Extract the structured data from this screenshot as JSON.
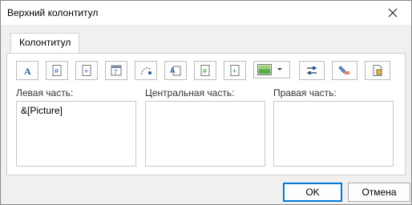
{
  "window": {
    "title": "Верхний колонтитул"
  },
  "tabs": [
    {
      "label": "Колонтитул"
    }
  ],
  "toolbar": {
    "buttons": [
      {
        "icon": "font-icon"
      },
      {
        "icon": "page-number-icon"
      },
      {
        "icon": "total-pages-icon"
      },
      {
        "icon": "date-icon"
      },
      {
        "icon": "time-icon"
      },
      {
        "icon": "file-path-icon"
      },
      {
        "icon": "file-name-icon"
      },
      {
        "icon": "sheet-name-icon"
      },
      {
        "icon": "insert-picture-icon"
      },
      {
        "icon": "picture-format-icon"
      },
      {
        "icon": "format-painter-icon"
      },
      {
        "icon": "insert-object-icon"
      }
    ]
  },
  "sections": {
    "left": {
      "label": "Левая часть:",
      "value": "&[Picture]"
    },
    "center": {
      "label": "Центральная часть:",
      "value": ""
    },
    "right": {
      "label": "Правая часть:",
      "value": ""
    }
  },
  "buttons": {
    "ok": "OK",
    "cancel": "Отмена"
  },
  "colors": {
    "accent": "#0078d7",
    "panel_bg": "#f0f0f0"
  }
}
